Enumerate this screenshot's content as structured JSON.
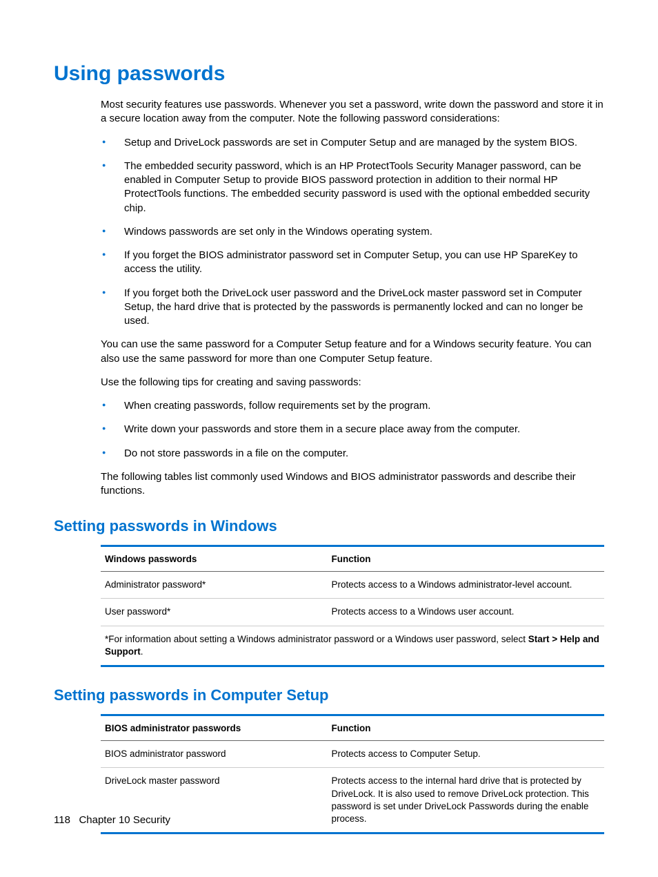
{
  "h1": "Using passwords",
  "intro": "Most security features use passwords. Whenever you set a password, write down the password and store it in a secure location away from the computer. Note the following password considerations:",
  "list1": [
    "Setup and DriveLock passwords are set in Computer Setup and are managed by the system BIOS.",
    "The embedded security password, which is an HP ProtectTools Security Manager password, can be enabled in Computer Setup to provide BIOS password protection in addition to their normal HP ProtectTools functions. The embedded security password is used with the optional embedded security chip.",
    "Windows passwords are set only in the Windows operating system.",
    "If you forget the BIOS administrator password set in Computer Setup, you can use HP SpareKey to access the utility.",
    "If you forget both the DriveLock user password and the DriveLock master password set in Computer Setup, the hard drive that is protected by the passwords is permanently locked and can no longer be used."
  ],
  "p2": "You can use the same password for a Computer Setup feature and for a Windows security feature. You can also use the same password for more than one Computer Setup feature.",
  "p3": "Use the following tips for creating and saving passwords:",
  "list2": [
    "When creating passwords, follow requirements set by the program.",
    "Write down your passwords and store them in a secure place away from the computer.",
    "Do not store passwords in a file on the computer."
  ],
  "p4": "The following tables list commonly used Windows and BIOS administrator passwords and describe their functions.",
  "h2a": "Setting passwords in Windows",
  "table1": {
    "headers": [
      "Windows passwords",
      "Function"
    ],
    "rows": [
      [
        "Administrator password*",
        "Protects access to a Windows administrator-level account."
      ],
      [
        "User password*",
        "Protects access to a Windows user account."
      ]
    ],
    "footnote_pre": "*For information about setting a Windows administrator password or a Windows user password, select ",
    "footnote_bold": "Start > Help and Support",
    "footnote_post": "."
  },
  "h2b": "Setting passwords in Computer Setup",
  "table2": {
    "headers": [
      "BIOS administrator passwords",
      "Function"
    ],
    "rows": [
      [
        "BIOS administrator password",
        "Protects access to Computer Setup."
      ],
      [
        "DriveLock master password",
        "Protects access to the internal hard drive that is protected by DriveLock. It is also used to remove DriveLock protection. This password is set under DriveLock Passwords during the enable process."
      ]
    ]
  },
  "footer": {
    "page": "118",
    "chapter": "Chapter 10   Security"
  }
}
